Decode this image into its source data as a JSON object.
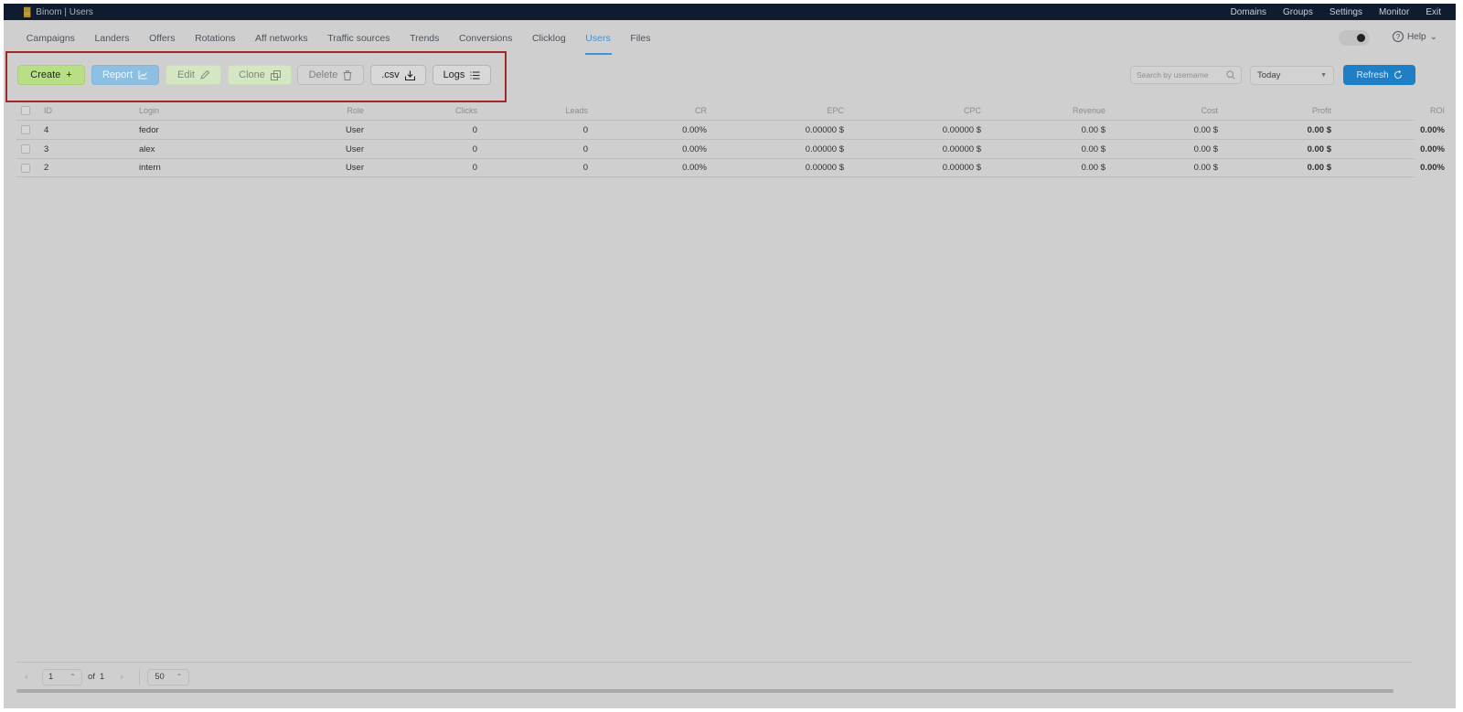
{
  "topbar": {
    "logo": "▓",
    "app_title": "Binom | Users",
    "links": [
      "Domains",
      "Groups",
      "Settings",
      "Monitor",
      "Exit"
    ]
  },
  "nav": {
    "tabs": [
      "Campaigns",
      "Landers",
      "Offers",
      "Rotations",
      "Aff networks",
      "Traffic sources",
      "Trends",
      "Conversions",
      "Clicklog",
      "Users",
      "Files"
    ],
    "active_tab": "Users",
    "help_label": "Help"
  },
  "toolbar": {
    "create_label": "Create",
    "report_label": "Report",
    "edit_label": "Edit",
    "clone_label": "Clone",
    "delete_label": "Delete",
    "csv_label": ".csv",
    "logs_label": "Logs",
    "search_placeholder": "Search by username",
    "period_value": "Today",
    "refresh_label": "Refresh"
  },
  "colors": {
    "create": "#b8de86",
    "report": "#8dbfe0",
    "refresh": "#1f7fc6",
    "active_tab": "#3f93d6",
    "highlight_border": "#a1252a"
  },
  "table": {
    "columns": [
      "ID",
      "Login",
      "Role",
      "Clicks",
      "Leads",
      "CR",
      "EPC",
      "CPC",
      "Revenue",
      "Cost",
      "Profit",
      "ROI"
    ],
    "rows": [
      {
        "id": "4",
        "login": "fedor",
        "role": "User",
        "clicks": "0",
        "leads": "0",
        "cr": "0.00%",
        "epc": "0.00000 $",
        "cpc": "0.00000 $",
        "revenue": "0.00 $",
        "cost": "0.00 $",
        "profit": "0.00 $",
        "roi": "0.00%"
      },
      {
        "id": "3",
        "login": "alex",
        "role": "User",
        "clicks": "0",
        "leads": "0",
        "cr": "0.00%",
        "epc": "0.00000 $",
        "cpc": "0.00000 $",
        "revenue": "0.00 $",
        "cost": "0.00 $",
        "profit": "0.00 $",
        "roi": "0.00%"
      },
      {
        "id": "2",
        "login": "intern",
        "role": "User",
        "clicks": "0",
        "leads": "0",
        "cr": "0.00%",
        "epc": "0.00000 $",
        "cpc": "0.00000 $",
        "revenue": "0.00 $",
        "cost": "0.00 $",
        "profit": "0.00 $",
        "roi": "0.00%"
      }
    ]
  },
  "pagination": {
    "current_page": "1",
    "of_label": "of",
    "total_pages": "1",
    "page_size": "50"
  }
}
